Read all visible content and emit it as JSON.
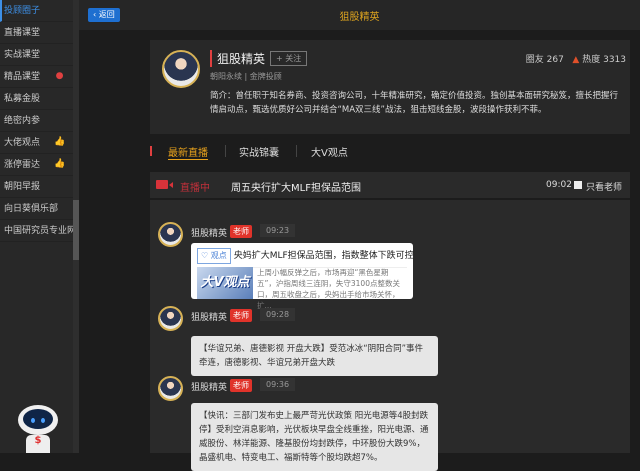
{
  "sidebar": {
    "items": [
      {
        "label": "投顾圈子",
        "active": true
      },
      {
        "label": "直播课堂"
      },
      {
        "label": "实战课堂"
      },
      {
        "label": "精品课堂",
        "badge": "fire-icon"
      },
      {
        "label": "私募金股"
      },
      {
        "label": "绝密内参"
      },
      {
        "label": "大佬观点",
        "badge": "thumbs-up-icon"
      },
      {
        "label": "涨停雷达",
        "badge": "thumbs-up-icon"
      },
      {
        "label": "朝阳早报"
      },
      {
        "label": "向日葵俱乐部"
      },
      {
        "label": "中国研究员专业网"
      }
    ]
  },
  "topbar": {
    "back_label": "‹ 返回",
    "title": "狙股精英"
  },
  "profile": {
    "name": "狙股精英",
    "follow_label": "+ 关注",
    "subtitle": "朝阳永续 | 金牌投顾",
    "fans_label": "圈友",
    "fans": "267",
    "heat_label": "热度",
    "heat": "3313",
    "intro": "简介：曾任职于知名券商、投资咨询公司，十年精准研究，确定价值投资。独创基本面研究秘笈，擅长把握行情启动点，甄选优质好公司并结合“MA双三线”战法，狙击短线金股，波段操作获利不菲。"
  },
  "tabs": [
    {
      "label": "最新直播",
      "active": true
    },
    {
      "label": "实战锦囊"
    },
    {
      "label": "大V观点"
    }
  ],
  "live": {
    "status": "直播中",
    "topic": "周五央行扩大MLF担保品范围",
    "time": "09:02",
    "only_teacher": "只看老师"
  },
  "messages": [
    {
      "name": "狙股精英",
      "badge": "老师",
      "time": "09:23",
      "tag": "观点",
      "title": "央妈扩大MLF担保品范围，指数整体下跌可控",
      "thumb": "大V观点",
      "desc": "上周小幅反弹之后，市场再迎“黑色星期五”，沪指周线三连阴，失守3100点整数关口，周五收盘之后，央妈出手给市场关怀，扩..."
    },
    {
      "name": "狙股精英",
      "badge": "老师",
      "time": "09:28",
      "text": "【华谊兄弟、唐德影视 开盘大跌】受范冰冰“阴阳合同”事件牵连，唐德影视、华谊兄弟开盘大跌"
    },
    {
      "name": "狙股精英",
      "badge": "老师",
      "time": "09:36",
      "text": "【快讯：三部门发布史上最严苛光伏政策 阳光电源等4股封跌停】受利空消息影响，光伏板块早盘全线重挫，阳光电源、通威股份、林洋能源、隆基股份均封跌停，中环股份大跌9%，晶盛机电、特变电工、福斯特等个股均跌超7%。"
    }
  ],
  "colors": {
    "accent": "#e8a21c",
    "live": "#c0303a",
    "link": "#3d8fe6"
  }
}
